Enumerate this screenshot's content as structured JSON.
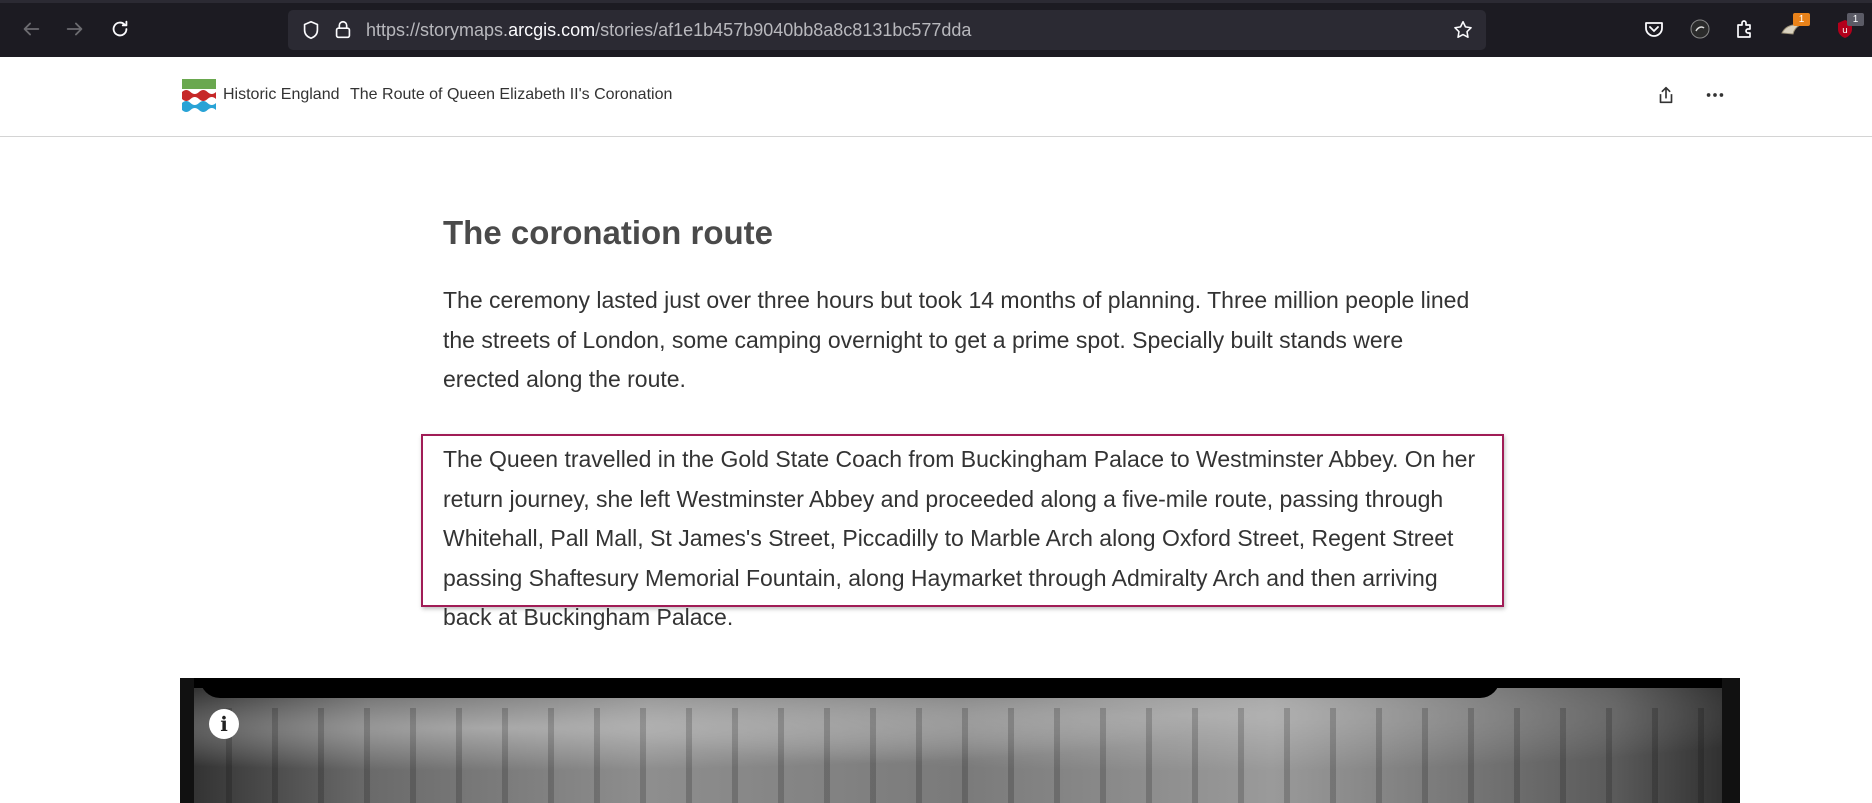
{
  "browser": {
    "url_prefix": "https://storymaps.",
    "url_domain": "arcgis.com",
    "url_path": "/stories/af1e1b457b9040bb8a8c8131bc577dda",
    "extensions": [
      {
        "name": "pocket-icon",
        "badge": ""
      },
      {
        "name": "extension-dark-icon",
        "badge": ""
      },
      {
        "name": "extensions-puzzle-icon",
        "badge": ""
      },
      {
        "name": "extension-orange-icon",
        "badge": "1"
      },
      {
        "name": "ublock-icon",
        "badge": "1"
      }
    ],
    "colors": {
      "chrome_bg": "#1c1b22",
      "urlbar_bg": "#2b2a33",
      "badge_orange": "#e8821a",
      "badge_gray": "#5b5b66"
    }
  },
  "story_header": {
    "org_name": "Historic England",
    "title": "The Route of Queen Elizabeth II's Coronation"
  },
  "content": {
    "heading": "The coronation route",
    "paragraph_1": "The ceremony lasted just over three hours but took 14 months of planning. Three million people lined the streets of London, some camping overnight to get a prime spot. Specially built stands were erected along the route.",
    "paragraph_2": "The Queen travelled in the Gold State Coach from Buckingham Palace to Westminster Abbey. On her return journey, she left Westminster Abbey and proceeded along a five-mile route, passing through Whitehall, Pall Mall, St James's Street, Piccadilly to Marble Arch along Oxford Street, Regent Street passing Shaftesury Memorial Fountain, along Haymarket through Admiralty Arch and then arriving back at Buckingham Palace.",
    "highlight_color": "#a01c56",
    "image_info_icon": "info-icon"
  }
}
